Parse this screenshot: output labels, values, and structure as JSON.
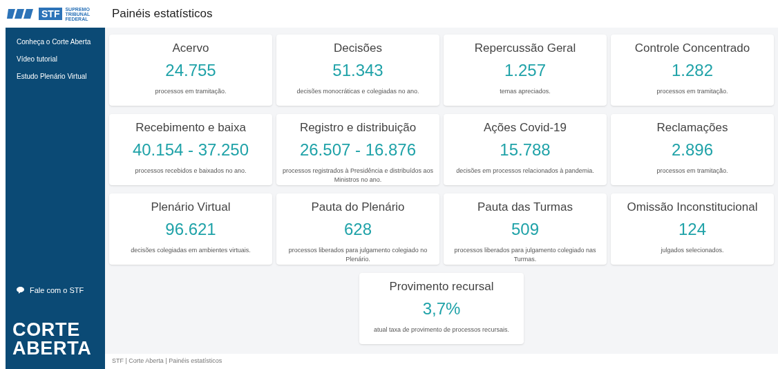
{
  "logo": {
    "mark": "STF",
    "subtitle": [
      "SUPREMO",
      "TRIBUNAL",
      "FEDERAL"
    ]
  },
  "page_title": "Painéis estatísticos",
  "sidebar": {
    "items": [
      {
        "label": "Conheça o Corte Aberta"
      },
      {
        "label": "Vídeo tutorial"
      },
      {
        "label": "Estudo Plenário Virtual"
      }
    ],
    "contact": "Fale com o STF",
    "brand": [
      "CORTE",
      "ABERTA"
    ]
  },
  "cards": [
    {
      "title": "Acervo",
      "value": "24.755",
      "caption": "processos em tramitação."
    },
    {
      "title": "Decisões",
      "value": "51.343",
      "caption": "decisões monocráticas e colegiadas no ano."
    },
    {
      "title": "Repercussão Geral",
      "value": "1.257",
      "caption": "temas apreciados."
    },
    {
      "title": "Controle Concentrado",
      "value": "1.282",
      "caption": "processos em tramitação."
    },
    {
      "title": "Recebimento e baixa",
      "value": "40.154 - 37.250",
      "caption": "processos recebidos e baixados no ano."
    },
    {
      "title": "Registro e distribuição",
      "value": "26.507 - 16.876",
      "caption": "processos registrados à Presidência e distribuídos aos Ministros no ano."
    },
    {
      "title": "Ações Covid-19",
      "value": "15.788",
      "caption": "decisões em processos relacionados à pandemia."
    },
    {
      "title": "Reclamações",
      "value": "2.896",
      "caption": "processos em tramitação."
    },
    {
      "title": "Plenário Virtual",
      "value": "96.621",
      "caption": "decisões colegiadas em ambientes virtuais."
    },
    {
      "title": "Pauta do Plenário",
      "value": "628",
      "caption": "processos liberados para julgamento colegiado no Plenário."
    },
    {
      "title": "Pauta das Turmas",
      "value": "509",
      "caption": "processos liberados para julgamento colegiado nas Turmas."
    },
    {
      "title": "Omissão Inconstitucional",
      "value": "124",
      "caption": "julgados selecionados."
    },
    {
      "title": "Provimento recursal",
      "value": "3,7%",
      "caption": "atual taxa de provimento de processos recursais."
    }
  ],
  "footer": "STF | Corte Aberta | Painéis estatísticos"
}
